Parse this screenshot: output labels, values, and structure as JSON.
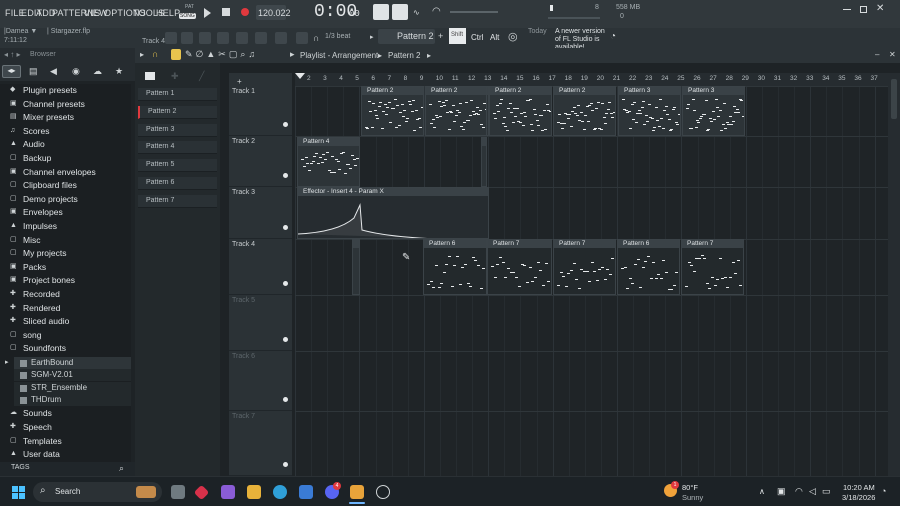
{
  "menu": [
    "FILE",
    "EDIT",
    "ADD",
    "PATTERNS",
    "VIEW",
    "OPTIONS",
    "TOOLS",
    "HELP"
  ],
  "transport": {
    "mode_top": "PAT",
    "mode_bottom": "SONG",
    "tempo": "120.022",
    "time": "0:00",
    "time_small": "00",
    "memory": "558 MB",
    "cpu_num": "8",
    "cpu_zero": "0"
  },
  "project": {
    "user": "|Damea ▼",
    "time": "7:11:12",
    "file": "| Stargazer.flp"
  },
  "toolbar": {
    "track_label": "Track 4",
    "snap": "1/3 beat",
    "pattern_selector": "Pattern 2",
    "shift": "Shift",
    "ctrl": "Ctrl",
    "alt": "Alt",
    "news_today": "Today",
    "news_text": "A newer version of FL Studio is available!"
  },
  "browser": {
    "title": "Browser",
    "items": [
      {
        "label": "Plugin presets",
        "icon": "◆"
      },
      {
        "label": "Channel presets",
        "icon": "▣"
      },
      {
        "label": "Mixer presets",
        "icon": "▤"
      },
      {
        "label": "Scores",
        "icon": "♫"
      },
      {
        "label": "Audio",
        "icon": "▲"
      },
      {
        "label": "Backup",
        "icon": "▢"
      },
      {
        "label": "Channel envelopes",
        "icon": "▣"
      },
      {
        "label": "Clipboard files",
        "icon": "▢"
      },
      {
        "label": "Demo projects",
        "icon": "▢"
      },
      {
        "label": "Envelopes",
        "icon": "▣"
      },
      {
        "label": "Impulses",
        "icon": "▲"
      },
      {
        "label": "Misc",
        "icon": "▢"
      },
      {
        "label": "My projects",
        "icon": "▢"
      },
      {
        "label": "Packs",
        "icon": "▣"
      },
      {
        "label": "Project bones",
        "icon": "▣"
      },
      {
        "label": "Recorded",
        "icon": "✚"
      },
      {
        "label": "Rendered",
        "icon": "✚"
      },
      {
        "label": "Sliced audio",
        "icon": "✚"
      },
      {
        "label": "song",
        "icon": "▢"
      },
      {
        "label": "Soundfonts",
        "icon": "▢"
      }
    ],
    "soundfonts": [
      "EarthBound",
      "SGM-V2.01",
      "STR_Ensemble",
      "THDrum"
    ],
    "items_after": [
      {
        "label": "Sounds",
        "icon": "☁"
      },
      {
        "label": "Speech",
        "icon": "✚"
      },
      {
        "label": "Templates",
        "icon": "▢"
      },
      {
        "label": "User data",
        "icon": "▲"
      }
    ],
    "tags_label": "TAGS"
  },
  "patterns": [
    "Pattern 1",
    "Pattern 2",
    "Pattern 3",
    "Pattern 4",
    "Pattern 5",
    "Pattern 6",
    "Pattern 7"
  ],
  "playlist": {
    "title": "Playlist - Arrangement",
    "pattern": "Pattern 2",
    "ruler": [
      "2",
      "3",
      "4",
      "5",
      "6",
      "7",
      "8",
      "9",
      "10",
      "11",
      "12",
      "13",
      "14",
      "15",
      "16",
      "17",
      "18",
      "19",
      "20",
      "21",
      "22",
      "23",
      "24",
      "25",
      "26",
      "27",
      "28",
      "29",
      "30",
      "31",
      "32",
      "33",
      "34",
      "35",
      "36",
      "37"
    ],
    "tracks": [
      "Track 1",
      "Track 2",
      "Track 3",
      "Track 4",
      "Track 5",
      "Track 6",
      "Track 7"
    ],
    "clips": {
      "t1": [
        "Pattern 2",
        "Pattern 2",
        "Pattern 2",
        "Pattern 2",
        "Pattern 3",
        "Pattern 3"
      ],
      "t2": [
        "Pattern 4"
      ],
      "t3": [
        "Effector - Insert 4 - Param X"
      ],
      "t4": [
        "Pattern 6",
        "Pattern 7",
        "Pattern 7",
        "Pattern 6",
        "Pattern 7"
      ]
    }
  },
  "taskbar": {
    "search": "Search",
    "weather_temp": "80°F",
    "weather_desc": "Sunny",
    "weather_badge": "1",
    "discord_badge": "4",
    "time": "10:20 AM",
    "date": "3/18/2026"
  }
}
